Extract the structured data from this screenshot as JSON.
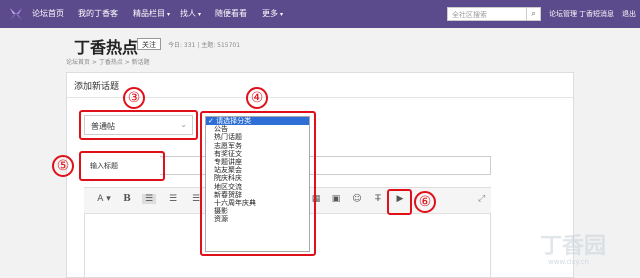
{
  "nav": {
    "items": [
      "论坛首页",
      "我的丁香客",
      "精品栏目",
      "找人",
      "随便看看",
      "更多"
    ],
    "search_placeholder": "全社区搜索",
    "util": [
      "论坛管理",
      "丁香短消息",
      "退出"
    ]
  },
  "header": {
    "title": "丁香热点",
    "follow": "关注",
    "stats": "今日: 331  |  主题: 515701",
    "breadcrumb": "论坛首页  >  丁香热点  >  新话题"
  },
  "panel": {
    "title": "添加新话题",
    "post_type": "普通帖",
    "title_placeholder": "输入标题"
  },
  "category_dropdown": {
    "options": [
      "✓ 请选择分类",
      "公告",
      "热门话题",
      "志愿军务",
      "有奖征文",
      "专题讲座",
      "站友聚会",
      "院庆科庆",
      "地区交流",
      "新春贺辞",
      "十六周年庆典",
      "摄影",
      "资源"
    ],
    "selected_index": 0
  },
  "markers": [
    "③",
    "④",
    "⑤",
    "⑥"
  ],
  "watermark": {
    "text": "丁香园",
    "url": "www.dxy.cn"
  },
  "colors": {
    "nav_bg": "#5b4a8c",
    "marker_red": "#e0101a",
    "selected_blue": "#2d6fd6"
  }
}
